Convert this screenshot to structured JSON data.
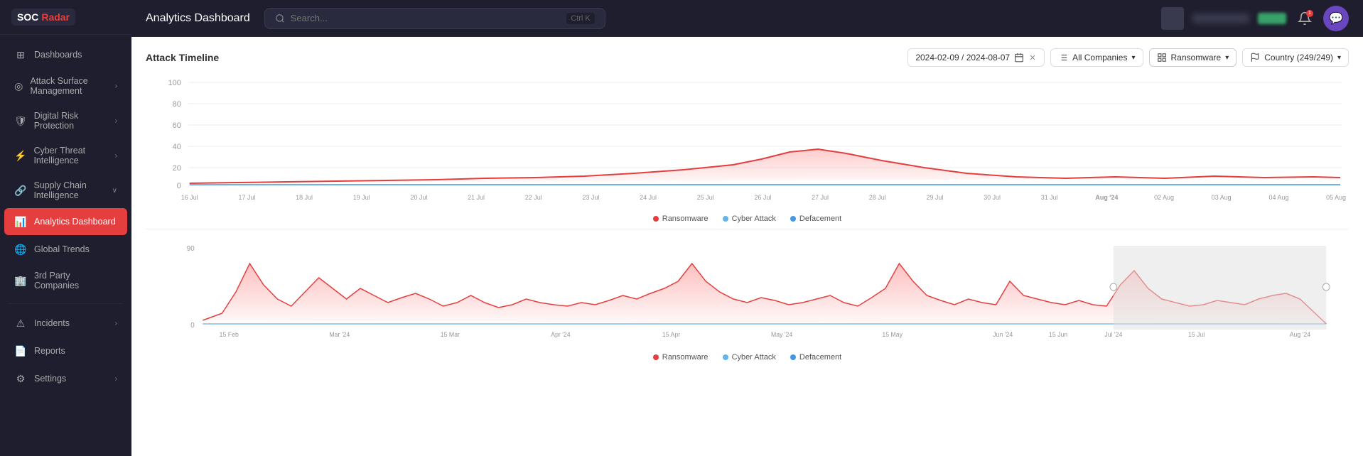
{
  "app": {
    "logo_soc": "SOC",
    "logo_radar": "Radar"
  },
  "header": {
    "title": "Analytics Dashboard",
    "search_placeholder": "Search...",
    "search_shortcut_mod": "Ctrl",
    "search_shortcut_key": "K"
  },
  "sidebar": {
    "items": [
      {
        "id": "dashboards",
        "label": "Dashboards",
        "icon": "⊞",
        "has_chevron": false,
        "active": false
      },
      {
        "id": "attack-surface",
        "label": "Attack Surface Management",
        "icon": "◎",
        "has_chevron": true,
        "active": false
      },
      {
        "id": "digital-risk",
        "label": "Digital Risk Protection",
        "icon": "🛡",
        "has_chevron": true,
        "active": false
      },
      {
        "id": "cyber-threat",
        "label": "Cyber Threat Intelligence",
        "icon": "⚡",
        "has_chevron": true,
        "active": false
      },
      {
        "id": "supply-chain",
        "label": "Supply Chain Intelligence",
        "icon": "🔗",
        "has_chevron": true,
        "active": false
      },
      {
        "id": "analytics-dashboard",
        "label": "Analytics Dashboard",
        "icon": "📊",
        "has_chevron": false,
        "active": true
      },
      {
        "id": "global-trends",
        "label": "Global Trends",
        "icon": "🌐",
        "has_chevron": false,
        "active": false
      },
      {
        "id": "3rd-party",
        "label": "3rd Party Companies",
        "icon": "🏢",
        "has_chevron": false,
        "active": false
      }
    ],
    "bottom_items": [
      {
        "id": "incidents",
        "label": "Incidents",
        "icon": "⚠",
        "has_chevron": true
      },
      {
        "id": "reports",
        "label": "Reports",
        "icon": "📄",
        "has_chevron": false
      },
      {
        "id": "settings",
        "label": "Settings",
        "icon": "⚙",
        "has_chevron": true
      }
    ]
  },
  "chart": {
    "title": "Attack Timeline",
    "date_range": "2024-02-09 / 2024-08-07",
    "filter_companies": "All Companies",
    "filter_type": "Ransomware",
    "filter_country": "Country (249/249)",
    "legend": [
      {
        "label": "Ransomware",
        "color": "#e53e3e"
      },
      {
        "label": "Cyber Attack",
        "color": "#63b3ed"
      },
      {
        "label": "Defacement",
        "color": "#4299e1"
      }
    ],
    "y_axis_top": [
      "100",
      "80",
      "60",
      "40",
      "20",
      "0"
    ],
    "x_axis_top": [
      "16 Jul",
      "17 Jul",
      "18 Jul",
      "19 Jul",
      "20 Jul",
      "21 Jul",
      "22 Jul",
      "23 Jul",
      "24 Jul",
      "25 Jul",
      "26 Jul",
      "27 Jul",
      "28 Jul",
      "29 Jul",
      "30 Jul",
      "31 Jul",
      "Aug '24",
      "02 Aug",
      "03 Aug",
      "04 Aug",
      "05 Aug"
    ],
    "y_axis_bottom": [
      "90",
      "0"
    ],
    "x_axis_bottom": [
      "15 Feb",
      "Mar '24",
      "15 Mar",
      "Apr '24",
      "15 Apr",
      "May '24",
      "15 May",
      "Jun '24",
      "15 Jun",
      "Jul '24",
      "15 Jul",
      "Aug '24"
    ]
  }
}
